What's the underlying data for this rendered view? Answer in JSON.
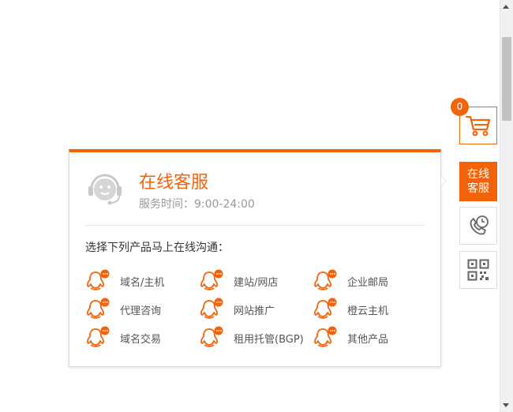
{
  "cart": {
    "count": "0"
  },
  "toolbar": {
    "service_label": "在线客服"
  },
  "popup": {
    "title": "在线客服",
    "hours": "服务时间：9:00-24:00",
    "prompt": "选择下列产品马上在线沟通：",
    "items": [
      {
        "label": "域名/主机"
      },
      {
        "label": "建站/网店"
      },
      {
        "label": "企业邮局"
      },
      {
        "label": "代理咨询"
      },
      {
        "label": "网站推广"
      },
      {
        "label": "橙云主机"
      },
      {
        "label": "域名交易"
      },
      {
        "label": "租用托管(BGP)"
      },
      {
        "label": "其他产品"
      }
    ]
  },
  "colors": {
    "accent": "#f3630a",
    "muted": "#999999"
  },
  "icons": [
    "cart-icon",
    "phone-clock-icon",
    "qr-code-icon",
    "headset-icon",
    "qq-chat-icon"
  ]
}
